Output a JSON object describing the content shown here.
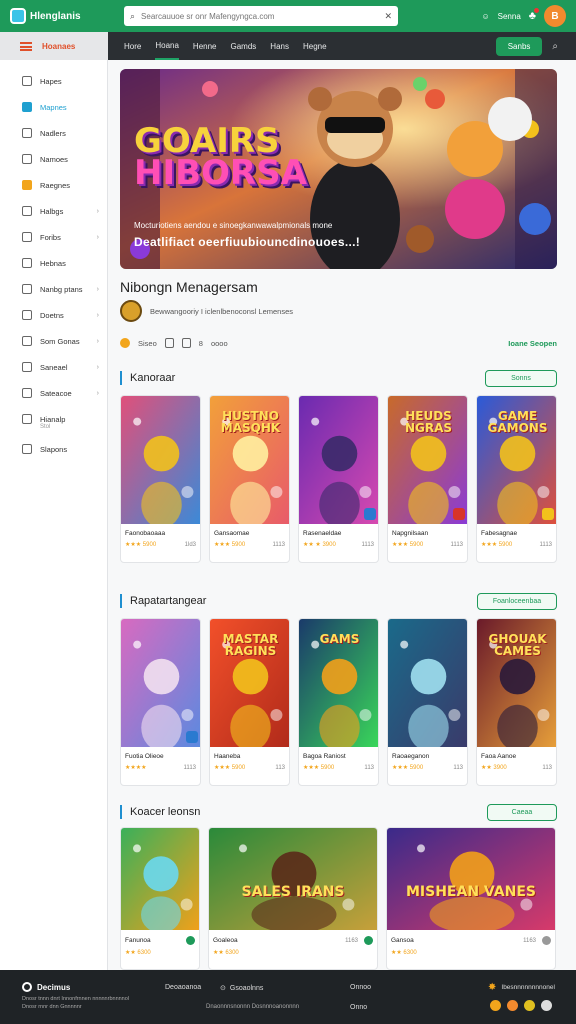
{
  "header": {
    "app_title": "Hlenglanis",
    "search_placeholder": "Searcauuoe sr onr Mafengyngca.com",
    "user_label": "Senna",
    "avatar_initial": "B"
  },
  "navbar": {
    "home_label": "Hoanaes",
    "tabs": [
      "Hore",
      "Hoana",
      "Henne",
      "Gamds",
      "Hans",
      "Hegne"
    ],
    "active_tab": 1,
    "button_label": "Sanbs"
  },
  "sidebar": {
    "items": [
      {
        "label": "Hapes",
        "chev": false
      },
      {
        "label": "Mapnes",
        "chev": false,
        "active": true
      },
      {
        "label": "Nadlers",
        "chev": false
      },
      {
        "label": "Namoes",
        "chev": false
      },
      {
        "label": "Raegnes",
        "chev": false,
        "orange": true
      },
      {
        "label": "Halbgs",
        "chev": true
      },
      {
        "label": "Foribs",
        "chev": true
      },
      {
        "label": "Hebnas",
        "chev": false
      },
      {
        "label": "Nanbg ptans",
        "chev": true
      },
      {
        "label": "Doetns",
        "chev": true
      },
      {
        "label": "Som Gonas",
        "chev": true
      },
      {
        "label": "Saneael",
        "chev": true
      },
      {
        "label": "Sateacoe",
        "chev": true
      },
      {
        "label": "Hianalp",
        "chev": false,
        "sub": "Stol"
      },
      {
        "label": "Slapons",
        "chev": false
      }
    ]
  },
  "hero": {
    "title_line1": "GOAIRS",
    "title_line2": "HIBORSA",
    "caption_small": "Mocturiotiens  aendou  e sinoegkanwawalpmionals mone",
    "caption_big": "Deatlifiact oeerfiuubiouncdinouoes...!"
  },
  "game": {
    "title": "Nibongn Menagersam",
    "developer": "Bewwangooriy I iclenlbenoconsl Lemenses",
    "meta": [
      "Siseo",
      "8",
      "oooo"
    ],
    "link": "Ioane Seopen"
  },
  "sections": [
    {
      "title": "Kanoraar",
      "button": "Sonns",
      "cards": [
        {
          "name": "Faonobaoaaa",
          "rating": "★★★ 5900",
          "count": "1ld3",
          "art_title": "",
          "badge": ""
        },
        {
          "name": "Gansaomae",
          "rating": "★★★ 5900",
          "count": "1113",
          "art_title": "HUSTNO MASQHK",
          "badge": ""
        },
        {
          "name": "Rasenaeldae",
          "rating": "★★ ★ 3900",
          "count": "1113",
          "art_title": "",
          "badge": "blue"
        },
        {
          "name": "Napgnilsaan",
          "rating": "★★★ 5900",
          "count": "1113",
          "art_title": "HEUDS NGRAS",
          "badge": "red"
        },
        {
          "name": "Fabesagnae",
          "rating": "★★★ 5900",
          "count": "1113",
          "art_title": "GAME GAMONS",
          "badge": "yellow"
        }
      ]
    },
    {
      "title": "Rapatartangear",
      "button": "Foanloceenbaa",
      "cards": [
        {
          "name": "Fuotia Olieoe",
          "rating": "★★★★",
          "count": "1113",
          "art_title": "",
          "badge": "blue"
        },
        {
          "name": "Haaneba",
          "rating": "★★★ 5900",
          "count": "113",
          "art_title": "MASTAR RAGINS",
          "badge": ""
        },
        {
          "name": "Bagoa Raniost",
          "rating": "★★★ 5900",
          "count": "113",
          "art_title": "GAMS",
          "badge": ""
        },
        {
          "name": "Raoaeganon",
          "rating": "★★★ 5900",
          "count": "113",
          "art_title": "",
          "badge": ""
        },
        {
          "name": "Faoa Aanoe",
          "rating": "★★ 3900",
          "count": "113",
          "art_title": "GHOUAK CAMES",
          "badge": ""
        }
      ]
    },
    {
      "title": "Koacer leonsn",
      "button": "Caeaa",
      "cards": [
        {
          "name": "Fanunoa",
          "rating": "★★ 6300",
          "icon": "green",
          "art_title": ""
        },
        {
          "name": "Goaleoa",
          "rating": "★★ 6300",
          "icon": "green",
          "extra": "1163",
          "art_title": "SALES IRANS"
        },
        {
          "name": "Gansoa",
          "rating": "★★ 6300",
          "icon": "grey",
          "extra": "1163",
          "art_title": "MISHEAN VANES"
        }
      ]
    }
  ],
  "footer": {
    "brand": "Decimus",
    "desc_line1": "Dnosr tnnn dnrt Innonfrnnen nnnnnrbnnnnol",
    "desc_line2": "Dnosr rnnr dnn Gnnnnnr",
    "link1": "Deoaoanoa",
    "link2": "Gsoaolnns",
    "link3": "Dnaonnnsnonnn Dosnnnoanonnnn",
    "link4": "Onnoo",
    "link5": "Onno",
    "right_label": "Ibesnnnnnnnnonel"
  },
  "colors": {
    "brand_green": "#1e9a5a",
    "nav_dark": "#2b2f33",
    "accent_blue": "#1f8fd0",
    "footer_dark": "#1f2326"
  }
}
